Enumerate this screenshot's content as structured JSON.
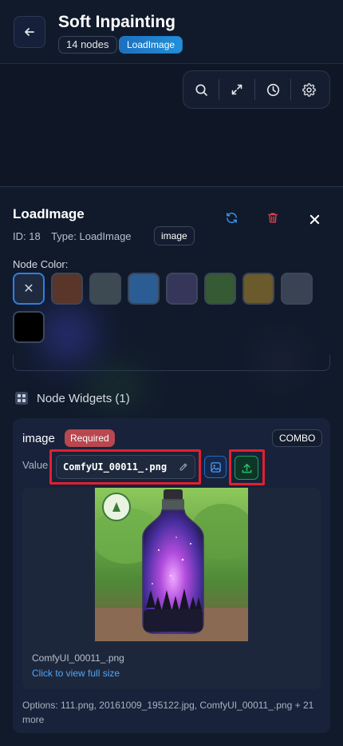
{
  "header": {
    "title": "Soft Inpainting",
    "nodes_badge": "14 nodes",
    "type_badge": "LoadImage"
  },
  "node": {
    "name": "LoadImage",
    "id_text": "ID: 18",
    "type_text": "Type: LoadImage",
    "output_badge": "image"
  },
  "node_color": {
    "label": "Node Color:",
    "selected_glyph": "✕",
    "swatches": [
      "#1f2a40",
      "#5a3529",
      "#3e4a51",
      "#2b5d94",
      "#36365a",
      "#365a33",
      "#6b5a2c",
      "#3a4354",
      "#000000"
    ]
  },
  "widgets": {
    "title": "Node Widgets (1)",
    "widget": {
      "name": "image",
      "required_badge": "Required",
      "type_badge": "COMBO",
      "value_label": "Value",
      "value": "ComfyUI_00011_.png",
      "preview_filename": "ComfyUI_00011_.png",
      "preview_link": "Click to view full size",
      "options_text": "Options: 111.png, 20161009_195122.jpg, ComfyUI_00011_.png + 21 more"
    }
  },
  "icons": {
    "back": "arrow-left-icon",
    "search": "search-icon",
    "fit": "expand-icon",
    "history": "clock-icon",
    "settings": "gear-icon",
    "refresh": "refresh-icon",
    "delete": "trash-icon",
    "close": "close-icon",
    "widgets": "widgets-icon",
    "edit": "pencil-icon",
    "image": "image-icon",
    "upload": "upload-icon"
  },
  "colors": {
    "accent_blue": "#2f7fe0",
    "danger": "#e0212f",
    "success": "#17a35b",
    "required": "#b8474f"
  }
}
